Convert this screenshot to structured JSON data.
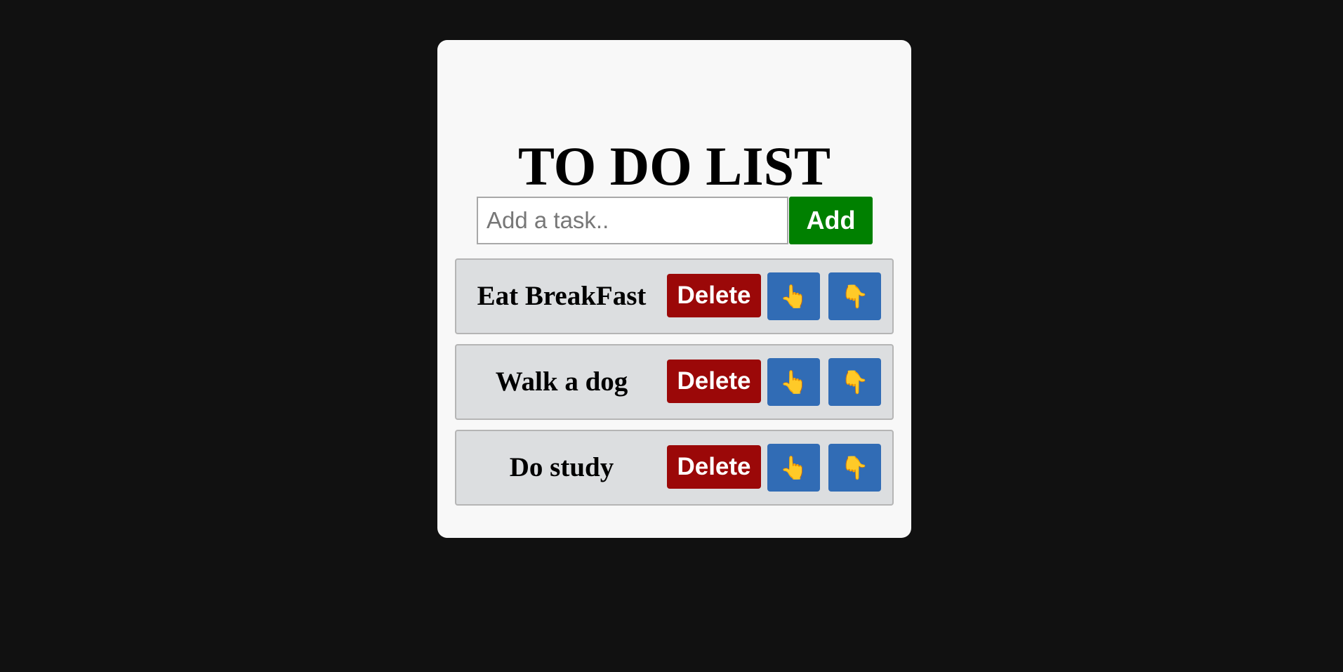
{
  "title": "TO DO LIST",
  "input": {
    "placeholder": "Add a task..",
    "value": ""
  },
  "add_label": "Add",
  "tasks": [
    {
      "text": "Eat BreakFast",
      "delete_label": "Delete",
      "up_icon": "👆",
      "down_icon": "👇"
    },
    {
      "text": "Walk a dog",
      "delete_label": "Delete",
      "up_icon": "👆",
      "down_icon": "👇"
    },
    {
      "text": "Do study",
      "delete_label": "Delete",
      "up_icon": "👆",
      "down_icon": "👇"
    }
  ],
  "icons": {
    "move_up": "pointing-up-icon",
    "move_down": "pointing-down-icon"
  },
  "colors": {
    "background": "#111111",
    "card": "#f8f8f8",
    "add_button": "#008000",
    "delete_button": "#9b0808",
    "move_button": "#316cb5",
    "task_row": "#dcdee0"
  }
}
